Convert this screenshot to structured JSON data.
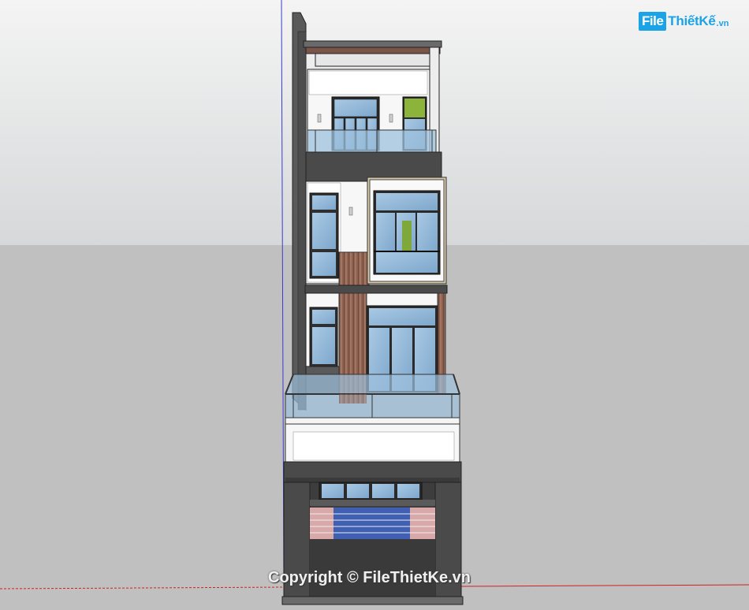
{
  "logo": {
    "box_text": "File",
    "text": "ThiếtKế",
    "suffix": ".vn"
  },
  "watermark": {
    "text": "Copyright © FileThietKe.vn"
  },
  "colors": {
    "sky": "#d8dadb",
    "ground": "#c2c2c2",
    "glass": "#9dbfd9",
    "wall_white": "#f7f7f7",
    "dark_gray": "#4a4a4a",
    "wood": "#8a5f4a",
    "logo_blue": "#1aa3e6",
    "axis_blue": "#3a3ad0",
    "axis_red": "#d02020"
  }
}
